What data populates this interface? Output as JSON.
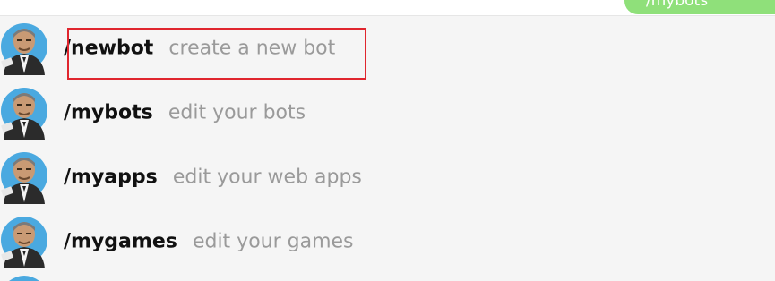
{
  "chat": {
    "sent_message": "/mybots"
  },
  "commands": [
    {
      "name": "/newbot",
      "description": "create a new bot"
    },
    {
      "name": "/mybots",
      "description": "edit your bots"
    },
    {
      "name": "/myapps",
      "description": "edit your web apps"
    },
    {
      "name": "/mygames",
      "description": "edit your games"
    }
  ],
  "colors": {
    "highlight": "#e0262e",
    "bubble": "#8fe07a",
    "avatar_ring": "#4aa9e0"
  }
}
